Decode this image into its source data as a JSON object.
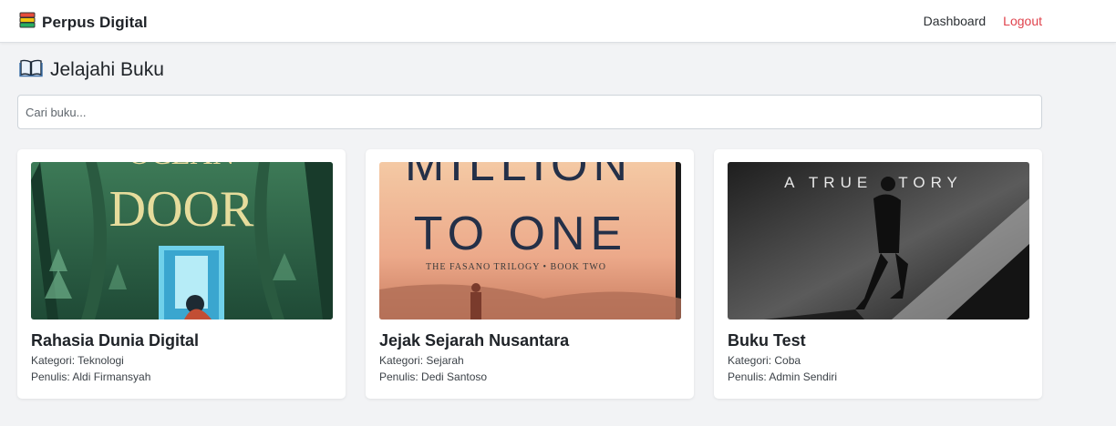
{
  "navbar": {
    "brand": "Perpus Digital",
    "brand_icon": "books-icon",
    "links": {
      "dashboard": "Dashboard",
      "logout": "Logout"
    }
  },
  "page": {
    "icon": "open-book-icon",
    "title": "Jelajahi Buku"
  },
  "search": {
    "placeholder": "Cari buku..."
  },
  "books": [
    {
      "title": "Rahasia Dunia Digital",
      "category": "Kategori: Teknologi",
      "author": "Penulis: Aldi Firmansyah",
      "cover_text": "DOOR",
      "cover_text_top": "OCEAN"
    },
    {
      "title": "Jejak Sejarah Nusantara",
      "category": "Kategori: Sejarah",
      "author": "Penulis: Dedi Santoso",
      "cover_text_top": "MILLION",
      "cover_text": "TO ONE",
      "cover_subtext": "THE FASANO TRILOGY • BOOK TWO"
    },
    {
      "title": "Buku Test",
      "category": "Kategori: Coba",
      "author": "Penulis: Admin Sendiri",
      "cover_text": "A  TRUE  STORY"
    }
  ],
  "colors": {
    "logout": "#e0424c",
    "background": "#f2f3f5"
  }
}
